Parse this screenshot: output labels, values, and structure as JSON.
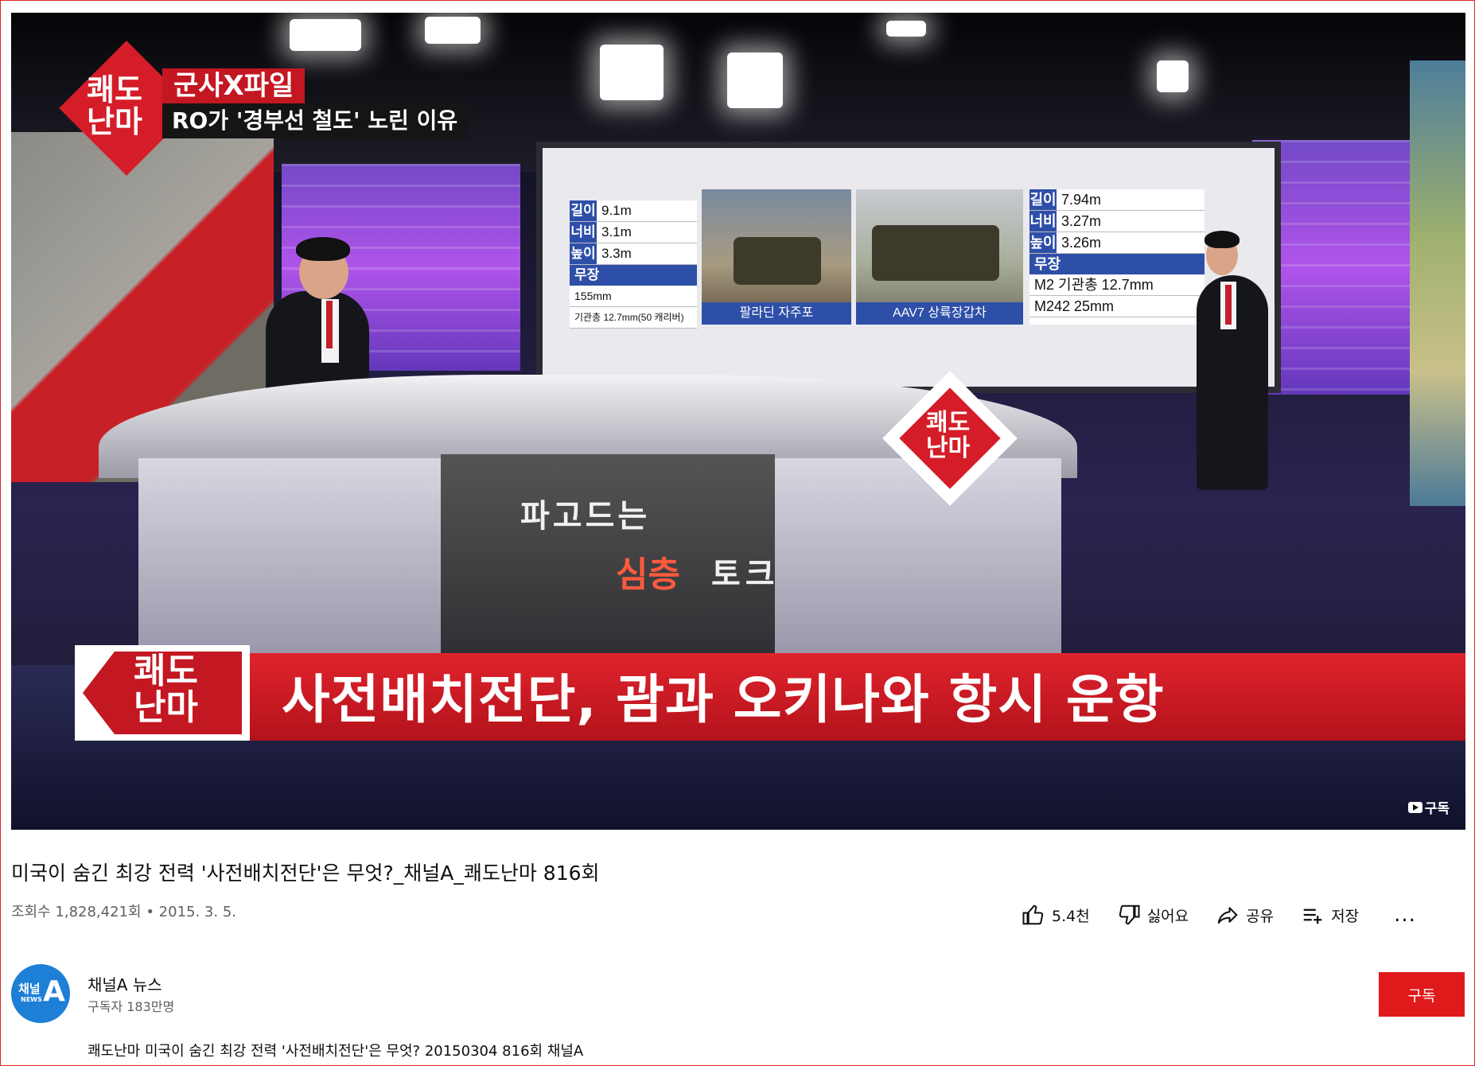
{
  "video": {
    "overlay": {
      "top_logo": "쾌도\n난마",
      "top_badge": "군사X파일",
      "top_subtitle": "RO가 '경부선 철도' 노린 이유",
      "desk_logo": "쾌도\n난마",
      "desk_panel_line1": "파고드는",
      "desk_panel_word_red": "심층",
      "desk_panel_word": "토크",
      "lower_third_logo": "쾌도\n난마",
      "lower_third_title": "사전배치전단, 괌과 오키나와 항시 운항",
      "watermark": "구독"
    },
    "screen": {
      "left_spec": {
        "rows": [
          {
            "k": "길이",
            "v": "9.1m"
          },
          {
            "k": "너비",
            "v": "3.1m"
          },
          {
            "k": "높이",
            "v": "3.3m"
          }
        ],
        "armament_label": "무장",
        "armament": [
          "155mm",
          "기관총 12.7mm(50 캐리버)"
        ]
      },
      "photo1_caption": "팔라딘 자주포",
      "photo2_caption": "AAV7 상륙장갑차",
      "right_spec": {
        "rows": [
          {
            "k": "길이",
            "v": "7.94m"
          },
          {
            "k": "너비",
            "v": "3.27m"
          },
          {
            "k": "높이",
            "v": "3.26m"
          }
        ],
        "armament_label": "무장",
        "armament": [
          "M2 기관총 12.7mm",
          "M242 25mm"
        ]
      }
    }
  },
  "title": "미국이 숨긴 최강 전력 '사전배치전단'은 무엇?_채널A_쾌도난마 816회",
  "meta": {
    "views": "조회수 1,828,421회",
    "separator": "•",
    "date": "2015. 3. 5."
  },
  "actions": {
    "like": "5.4천",
    "dislike": "싫어요",
    "share": "공유",
    "save": "저장",
    "more": "..."
  },
  "channel": {
    "avatar_text1": "채널",
    "avatar_text2": "NEWS",
    "avatar_text3": "A",
    "name": "채널A 뉴스",
    "subscribers": "구독자 183만명",
    "subscribe_label": "구독"
  },
  "description": "쾌도난마 미국이 숨긴 최강 전력 '사전배치전단'은 무엇? 20150304 816회 채널A",
  "colors": {
    "brand_red": "#c31722",
    "subscribe": "#e01a1a",
    "avatar_blue": "#1e7fd6"
  }
}
